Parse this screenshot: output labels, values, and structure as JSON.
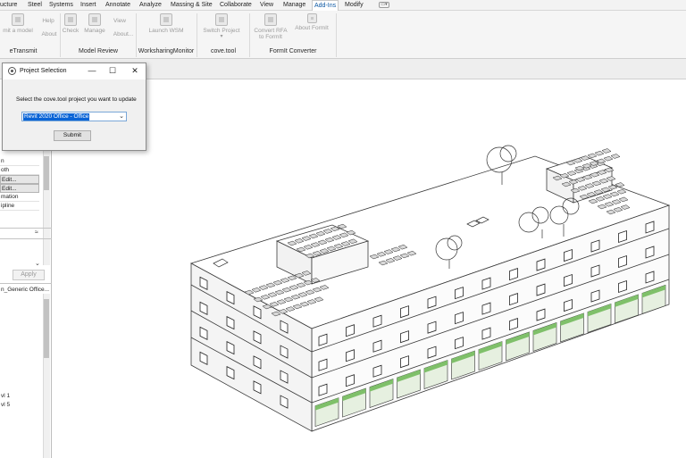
{
  "ribbon": {
    "tabs": [
      {
        "label": "ucture",
        "active": false
      },
      {
        "label": "Steel",
        "active": false
      },
      {
        "label": "Systems",
        "active": false
      },
      {
        "label": "Insert",
        "active": false
      },
      {
        "label": "Annotate",
        "active": false
      },
      {
        "label": "Analyze",
        "active": false
      },
      {
        "label": "Massing & Site",
        "active": false
      },
      {
        "label": "Collaborate",
        "active": false
      },
      {
        "label": "View",
        "active": false
      },
      {
        "label": "Manage",
        "active": false
      },
      {
        "label": "Add-Ins",
        "active": true
      },
      {
        "label": "Modify",
        "active": false
      }
    ],
    "buttons": {
      "submit_model": "mit a model",
      "help": "Help",
      "about": "About",
      "check": "Check",
      "manage": "Manage",
      "view": "View",
      "about2": "About...",
      "launch_wsm": "Launch WSM",
      "switch_project": "Switch Project",
      "convert_rfa_1": "Convert RFA",
      "convert_rfa_2": "to FormIt",
      "about_formit": "About FormIt"
    },
    "groups": {
      "etransmit": "eTransmit",
      "model_review": "Model Review",
      "worksharing": "WorksharingMonitor",
      "covetool": "cove.tool",
      "formit": "FormIt Converter"
    }
  },
  "properties": {
    "rows": [
      "n",
      "oth",
      "Edit...",
      "Edit...",
      "mation",
      "ipline"
    ],
    "apply_label": "Apply",
    "browser_item": "n_Generic Office...",
    "levels": [
      "vl 1",
      "vl 5"
    ]
  },
  "dialog": {
    "title": "Project Selection",
    "prompt": "Select the cove.tool project you want to update",
    "selected_project": "Revit 2020 Office - Office",
    "submit_label": "Submit",
    "minimize_glyph": "—",
    "maximize_glyph": "☐",
    "close_glyph": "✕"
  },
  "icons": {
    "dialog_icon": "covetool-logo-icon",
    "dropdown_chevron": "chevron-down-icon",
    "collapse_chevron": "chevron-up-icon"
  },
  "colors": {
    "selection_blue": "#0a64d6",
    "active_tab_text": "#0b57a3"
  }
}
